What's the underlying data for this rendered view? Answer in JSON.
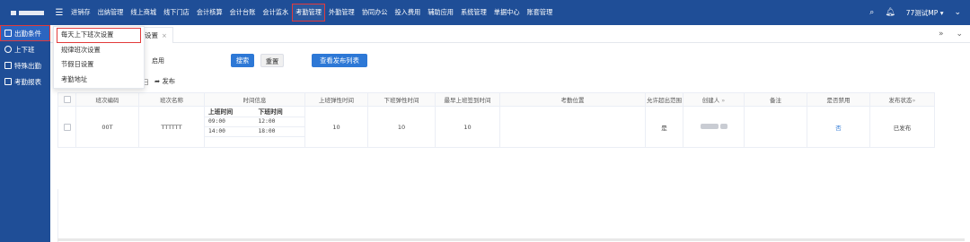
{
  "topnav": {
    "menu": [
      {
        "label": "进销存",
        "active": false
      },
      {
        "label": "出纳管理",
        "active": false
      },
      {
        "label": "线上商城",
        "active": false
      },
      {
        "label": "线下门店",
        "active": false
      },
      {
        "label": "会计核算",
        "active": false
      },
      {
        "label": "会计台账",
        "active": false
      },
      {
        "label": "会计监水",
        "active": false
      },
      {
        "label": "考勤管理",
        "active": true
      },
      {
        "label": "外勤管理",
        "active": false
      },
      {
        "label": "协同办公",
        "active": false
      },
      {
        "label": "投入费用",
        "active": false
      },
      {
        "label": "辅助应用",
        "active": false
      },
      {
        "label": "系统管理",
        "active": false
      },
      {
        "label": "单据中心",
        "active": false
      },
      {
        "label": "账套管理",
        "active": false
      }
    ],
    "user_label": "77测试MP"
  },
  "sidebar": {
    "items": [
      {
        "label": "出勤条件",
        "active": true
      },
      {
        "label": "上下班",
        "active": false
      },
      {
        "label": "特殊出勤",
        "active": false
      },
      {
        "label": "考勤报表",
        "active": false
      }
    ]
  },
  "tabs": {
    "visible_tab_fragment": "设置"
  },
  "dropdown": {
    "items": [
      {
        "label": "每天上下班次设置",
        "active": true
      },
      {
        "label": "规律班次设置",
        "active": false
      },
      {
        "label": "节假日设置",
        "active": false
      },
      {
        "label": "考勤地址",
        "active": false
      }
    ]
  },
  "filters": {
    "status_select_value": "启用",
    "search_label": "搜索",
    "reset_label": "重置",
    "view_publish_label": "查看发布列表"
  },
  "toolbar": {
    "fragment": "日",
    "publish_label": "发布"
  },
  "table": {
    "headers": [
      "",
      "班次编码",
      "班次名称",
      "时间信息",
      "上班弹性时间",
      "下班弹性时间",
      "最早上班签到时间",
      "考勤位置",
      "允许超出范围",
      "创建人",
      "备注",
      "是否禁用",
      "发布状态"
    ],
    "time_headers": [
      "上班时间",
      "下班时间"
    ],
    "rows": [
      {
        "code": "00T",
        "name": "TTTTTT",
        "times": [
          [
            "09:00",
            "12:00"
          ],
          [
            "14:00",
            "18:00"
          ]
        ],
        "work_flex": "10",
        "off_flex": "10",
        "earliest_sign": "10",
        "location": "",
        "allow_out": "是",
        "creator": "",
        "remark": "",
        "disabled": "否",
        "publish_status": "已发布"
      }
    ]
  }
}
